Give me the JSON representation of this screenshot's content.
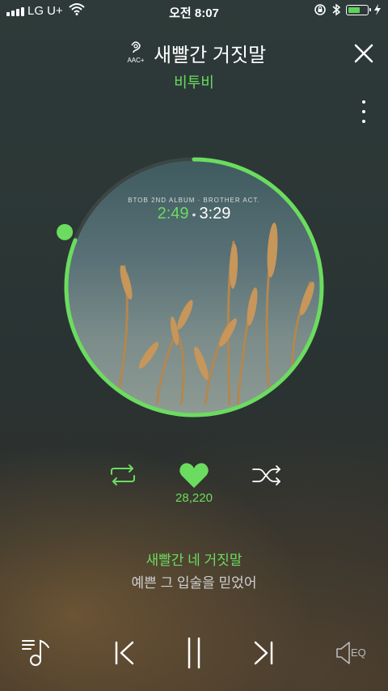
{
  "status_bar": {
    "carrier": "LG U+",
    "time": "오전 8:07",
    "battery_level_fraction": 0.55
  },
  "header": {
    "codec_label": "AAC+",
    "song_title": "새빨간 거짓말",
    "artist": "비투비"
  },
  "album": {
    "caption": "BTOB 2ND ALBUM · BROTHER ACT.",
    "current_time": "2:49",
    "total_time": "3:29",
    "progress_fraction": 0.81
  },
  "actions": {
    "like_count": "28,220"
  },
  "lyrics": {
    "current_line": "새빨간 네 거짓말",
    "next_line": "예쁜 그 입술을 믿었어"
  },
  "controls": {
    "eq_label": "EQ"
  },
  "colors": {
    "accent": "#6bdc5f"
  }
}
